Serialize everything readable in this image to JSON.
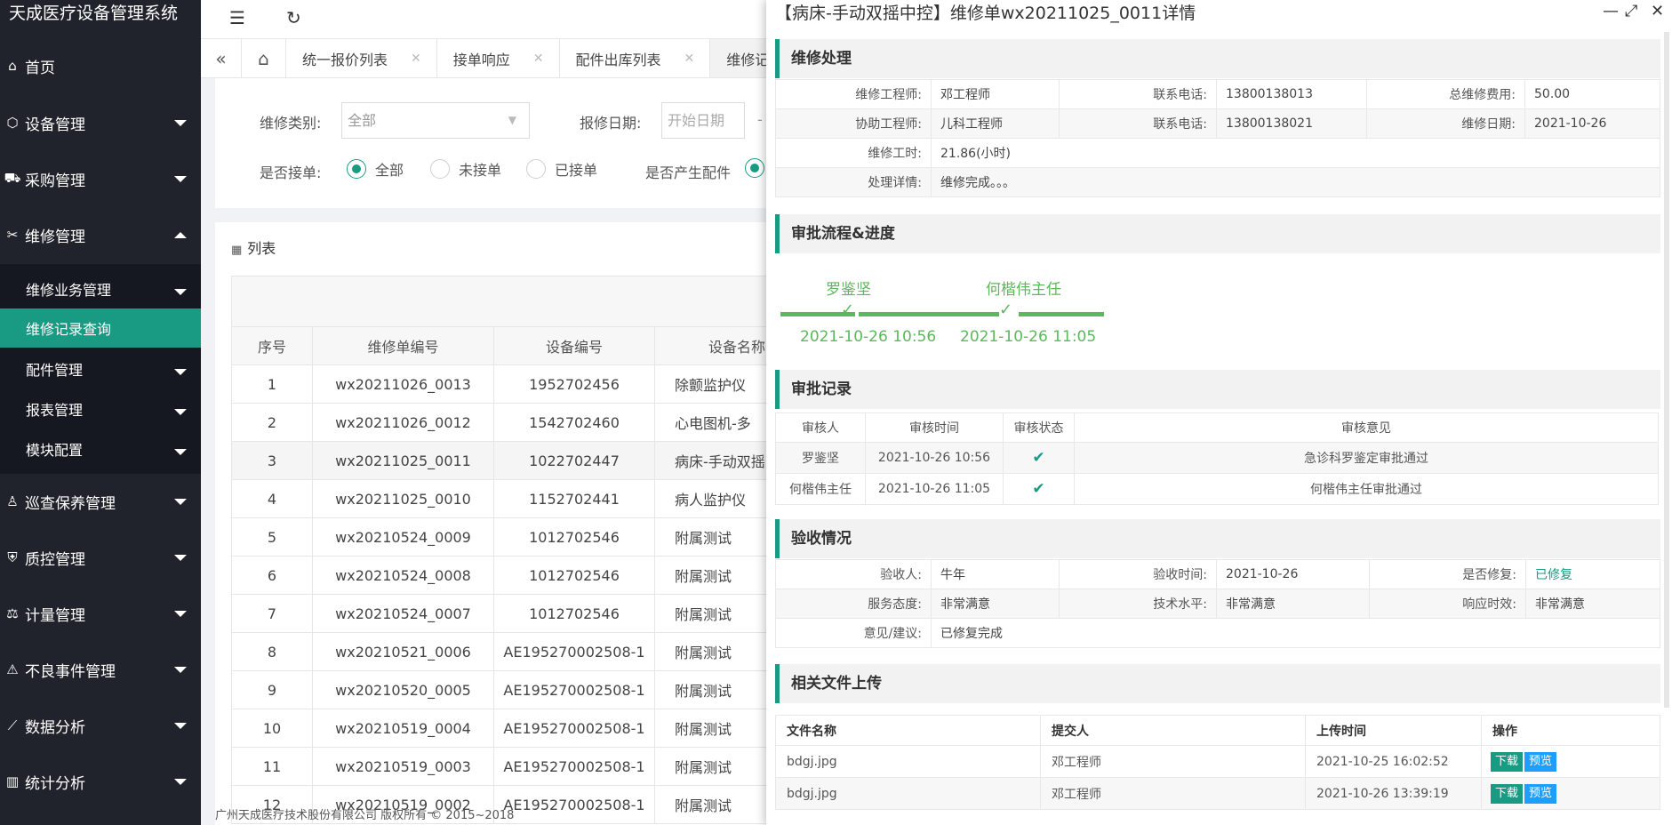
{
  "app": {
    "title": "天成医疗设备管理系统"
  },
  "sidebar": {
    "items": [
      {
        "label": "首页",
        "icon": "home-icon"
      },
      {
        "label": "设备管理",
        "icon": "cube-icon"
      },
      {
        "label": "采购管理",
        "icon": "cart-icon"
      },
      {
        "label": "维修管理",
        "icon": "tools-icon"
      },
      {
        "label": "巡查保养管理",
        "icon": "inspect-icon"
      },
      {
        "label": "质控管理",
        "icon": "shield-icon"
      },
      {
        "label": "计量管理",
        "icon": "scale-icon"
      },
      {
        "label": "不良事件管理",
        "icon": "warning-icon"
      },
      {
        "label": "数据分析",
        "icon": "trend-icon"
      },
      {
        "label": "统计分析",
        "icon": "bar-chart-icon"
      }
    ],
    "subitems": [
      {
        "label": "维修业务管理"
      },
      {
        "label": "维修记录查询"
      },
      {
        "label": "配件管理"
      },
      {
        "label": "报表管理"
      },
      {
        "label": "模块配置"
      }
    ]
  },
  "tabs": [
    {
      "label": "统一报价列表"
    },
    {
      "label": "接单响应"
    },
    {
      "label": "配件出库列表"
    },
    {
      "label": "维修记录查"
    }
  ],
  "filters": {
    "repair_type_label": "维修类别:",
    "repair_type_value": "全部",
    "date_label": "报修日期:",
    "date_placeholder": "开始日期",
    "date_sep": "-",
    "accepted_label": "是否接单:",
    "accepted_options": [
      "全部",
      "未接单",
      "已接单"
    ],
    "parts_label": "是否产生配件"
  },
  "list": {
    "heading": "列表",
    "columns": [
      "序号",
      "维修单编号",
      "设备编号",
      "设备名称"
    ],
    "rows": [
      [
        "1",
        "wx20211026_0013",
        "1952702456",
        "除颤监护仪"
      ],
      [
        "2",
        "wx20211026_0012",
        "1542702460",
        "心电图机-多"
      ],
      [
        "3",
        "wx20211025_0011",
        "1022702447",
        "病床-手动双摇"
      ],
      [
        "4",
        "wx20211025_0010",
        "1152702441",
        "病人监护仪"
      ],
      [
        "5",
        "wx20210524_0009",
        "1012702546",
        "附属测试"
      ],
      [
        "6",
        "wx20210524_0008",
        "1012702546",
        "附属测试"
      ],
      [
        "7",
        "wx20210524_0007",
        "1012702546",
        "附属测试"
      ],
      [
        "8",
        "wx20210521_0006",
        "AE195270002508-1",
        "附属测试"
      ],
      [
        "9",
        "wx20210520_0005",
        "AE195270002508-1",
        "附属测试"
      ],
      [
        "10",
        "wx20210519_0004",
        "AE195270002508-1",
        "附属测试"
      ],
      [
        "11",
        "wx20210519_0003",
        "AE195270002508-1",
        "附属测试"
      ],
      [
        "12",
        "wx20210519_0002",
        "AE195270002508-1",
        "附属测试"
      ]
    ]
  },
  "footer": {
    "text": "广州天成医疗技术股份有限公司 版权所有 © 2015~2018"
  },
  "modal": {
    "title": "【病床-手动双摇中控】维修单wx20211025_0011详情",
    "repair": {
      "heading": "维修处理",
      "engineer_label": "维修工程师:",
      "engineer": "邓工程师",
      "phone_label": "联系电话:",
      "phone": "13800138013",
      "total_cost_label": "总维修费用:",
      "total_cost": "50.00",
      "assist_label": "协助工程师:",
      "assist": "儿科工程师",
      "phone2_label": "联系电话:",
      "phone2": "13800138021",
      "repair_date_label": "维修日期:",
      "repair_date": "2021-10-26",
      "hours_label": "维修工时:",
      "hours": "21.86(小时)",
      "detail_label": "处理详情:",
      "detail": "维修完成。。。"
    },
    "flow": {
      "heading": "审批流程&进度",
      "steps": [
        {
          "name": "罗鉴坚",
          "time": "2021-10-26 10:56"
        },
        {
          "name": "何楷伟主任",
          "time": "2021-10-26 11:05"
        }
      ]
    },
    "approval": {
      "heading": "审批记录",
      "columns": [
        "审核人",
        "审核时间",
        "审核状态",
        "审核意见"
      ],
      "rows": [
        {
          "who": "罗鉴坚",
          "time": "2021-10-26 10:56",
          "comment": "急诊科罗鉴定审批通过"
        },
        {
          "who": "何楷伟主任",
          "time": "2021-10-26 11:05",
          "comment": "何楷伟主任审批通过"
        }
      ]
    },
    "acceptance": {
      "heading": "验收情况",
      "person_label": "验收人:",
      "person": "牛年",
      "time_label": "验收时间:",
      "time": "2021-10-26",
      "fixed_label": "是否修复:",
      "fixed": "已修复",
      "service_label": "服务态度:",
      "service": "非常满意",
      "skill_label": "技术水平:",
      "skill": "非常满意",
      "response_label": "响应时效:",
      "response": "非常满意",
      "advice_label": "意见/建议:",
      "advice": "已修复完成"
    },
    "files": {
      "heading": "相关文件上传",
      "columns": [
        "文件名称",
        "提交人",
        "上传时间",
        "操作"
      ],
      "rows": [
        {
          "name": "bdgj.jpg",
          "who": "邓工程师",
          "time": "2021-10-25 16:02:52"
        },
        {
          "name": "bdgj.jpg",
          "who": "邓工程师",
          "time": "2021-10-26 13:39:19"
        }
      ],
      "download": "下载",
      "preview": "预览"
    }
  }
}
